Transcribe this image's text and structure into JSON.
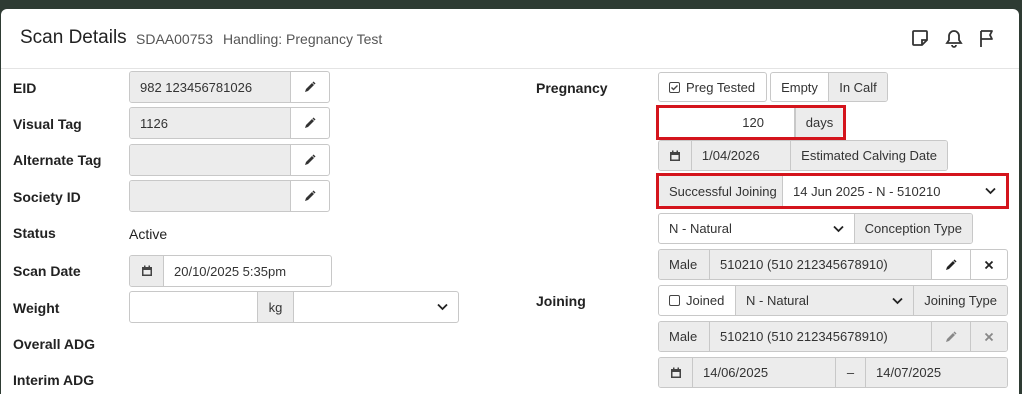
{
  "header": {
    "title": "Scan Details",
    "animal_id": "SDAA00753",
    "handling": "Handling: Pregnancy Test"
  },
  "left": {
    "eid": {
      "label": "EID",
      "value": "982 123456781026"
    },
    "visual_tag": {
      "label": "Visual Tag",
      "value": "1126"
    },
    "alternate_tag": {
      "label": "Alternate Tag",
      "value": ""
    },
    "society_id": {
      "label": "Society ID",
      "value": ""
    },
    "status": {
      "label": "Status",
      "value": "Active"
    },
    "scan_date": {
      "label": "Scan Date",
      "value": "20/10/2025 5:35pm"
    },
    "weight": {
      "label": "Weight",
      "value": "",
      "unit": "kg",
      "select_value": ""
    },
    "overall_adg": {
      "label": "Overall ADG"
    },
    "interim_adg": {
      "label": "Interim ADG"
    }
  },
  "pregnancy": {
    "label": "Pregnancy",
    "preg_tested": "Preg Tested",
    "options": [
      "Empty",
      "In Calf"
    ],
    "selected": "In Calf",
    "days_value": "120",
    "days_unit": "days",
    "calving_date": "1/04/2026",
    "calving_label": "Estimated Calving Date",
    "joining_label": "Successful Joining",
    "joining_value": "14 Jun 2025 - N - 510210",
    "conception_value": "N - Natural",
    "conception_label": "Conception Type",
    "sire_sex": "Male",
    "sire_value": "510210 (510 212345678910)"
  },
  "joining": {
    "label": "Joining",
    "joined_label": "Joined",
    "type_value": "N - Natural",
    "type_label": "Joining Type",
    "sire_sex": "Male",
    "sire_value": "510210 (510 212345678910)",
    "date_from": "14/06/2025",
    "date_sep": "–",
    "date_to": "14/07/2025"
  },
  "colors": {
    "highlight": "#d4141c",
    "backdrop": "#2e3b33"
  }
}
